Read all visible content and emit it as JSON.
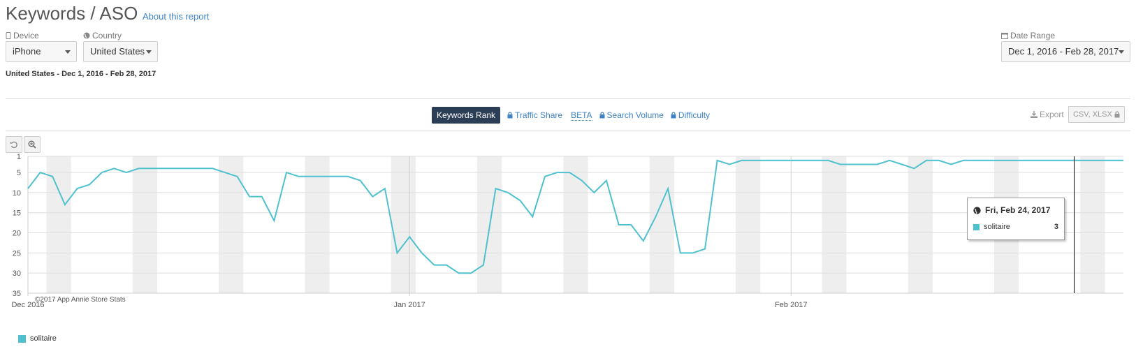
{
  "header": {
    "title": "Keywords / ASO",
    "about_link": "About this report"
  },
  "filters": {
    "device": {
      "label": "Device",
      "value": "iPhone"
    },
    "country": {
      "label": "Country",
      "value": "United States"
    },
    "date_range": {
      "label": "Date Range",
      "value": "Dec 1, 2016 - Feb 28, 2017"
    }
  },
  "summary": "United States - Dec 1, 2016 - Feb 28, 2017",
  "tabs": {
    "keywords_rank": "Keywords Rank",
    "traffic_share": "Traffic Share",
    "beta": "BETA",
    "search_volume": "Search Volume",
    "difficulty": "Difficulty"
  },
  "export": {
    "label": "Export",
    "formats": "CSV, XLSX"
  },
  "tooltip": {
    "date": "Fri, Feb 24, 2017",
    "series": "solitaire",
    "value": "3"
  },
  "colors": {
    "series": "#4fc1ce",
    "accent": "#2b3e55",
    "link": "#3f83c6",
    "weekend_band": "#eeeeee"
  },
  "chart_data": {
    "type": "line",
    "x_start": "2016-12-01",
    "x_end": "2017-02-28",
    "x_tick_labels": [
      "Dec 2016",
      "Jan 2017",
      "Feb 2017"
    ],
    "y_tick_labels": [
      "1",
      "5",
      "10",
      "15",
      "20",
      "25",
      "30",
      "35"
    ],
    "y_inverted": true,
    "ylim": [
      1,
      35
    ],
    "credit": "©2017 App Annie Store Stats",
    "series": [
      {
        "name": "solitaire",
        "values": [
          9,
          5,
          6,
          13,
          9,
          8,
          5,
          4,
          5,
          4,
          4,
          4,
          4,
          4,
          4,
          4,
          5,
          6,
          11,
          11,
          17,
          5,
          6,
          6,
          6,
          6,
          6,
          7,
          11,
          9,
          25,
          21,
          25,
          28,
          28,
          30,
          30,
          28,
          9,
          10,
          12,
          16,
          6,
          5,
          5,
          7,
          10,
          7,
          18,
          18,
          22,
          16,
          9,
          25,
          25,
          24,
          2,
          3,
          2,
          2,
          2,
          2,
          2,
          2,
          2,
          2,
          3,
          3,
          3,
          3,
          2,
          3,
          4,
          2,
          2,
          3,
          2,
          2,
          2,
          2,
          2,
          2,
          2,
          2,
          2,
          2,
          2,
          2,
          2,
          2
        ]
      }
    ]
  }
}
